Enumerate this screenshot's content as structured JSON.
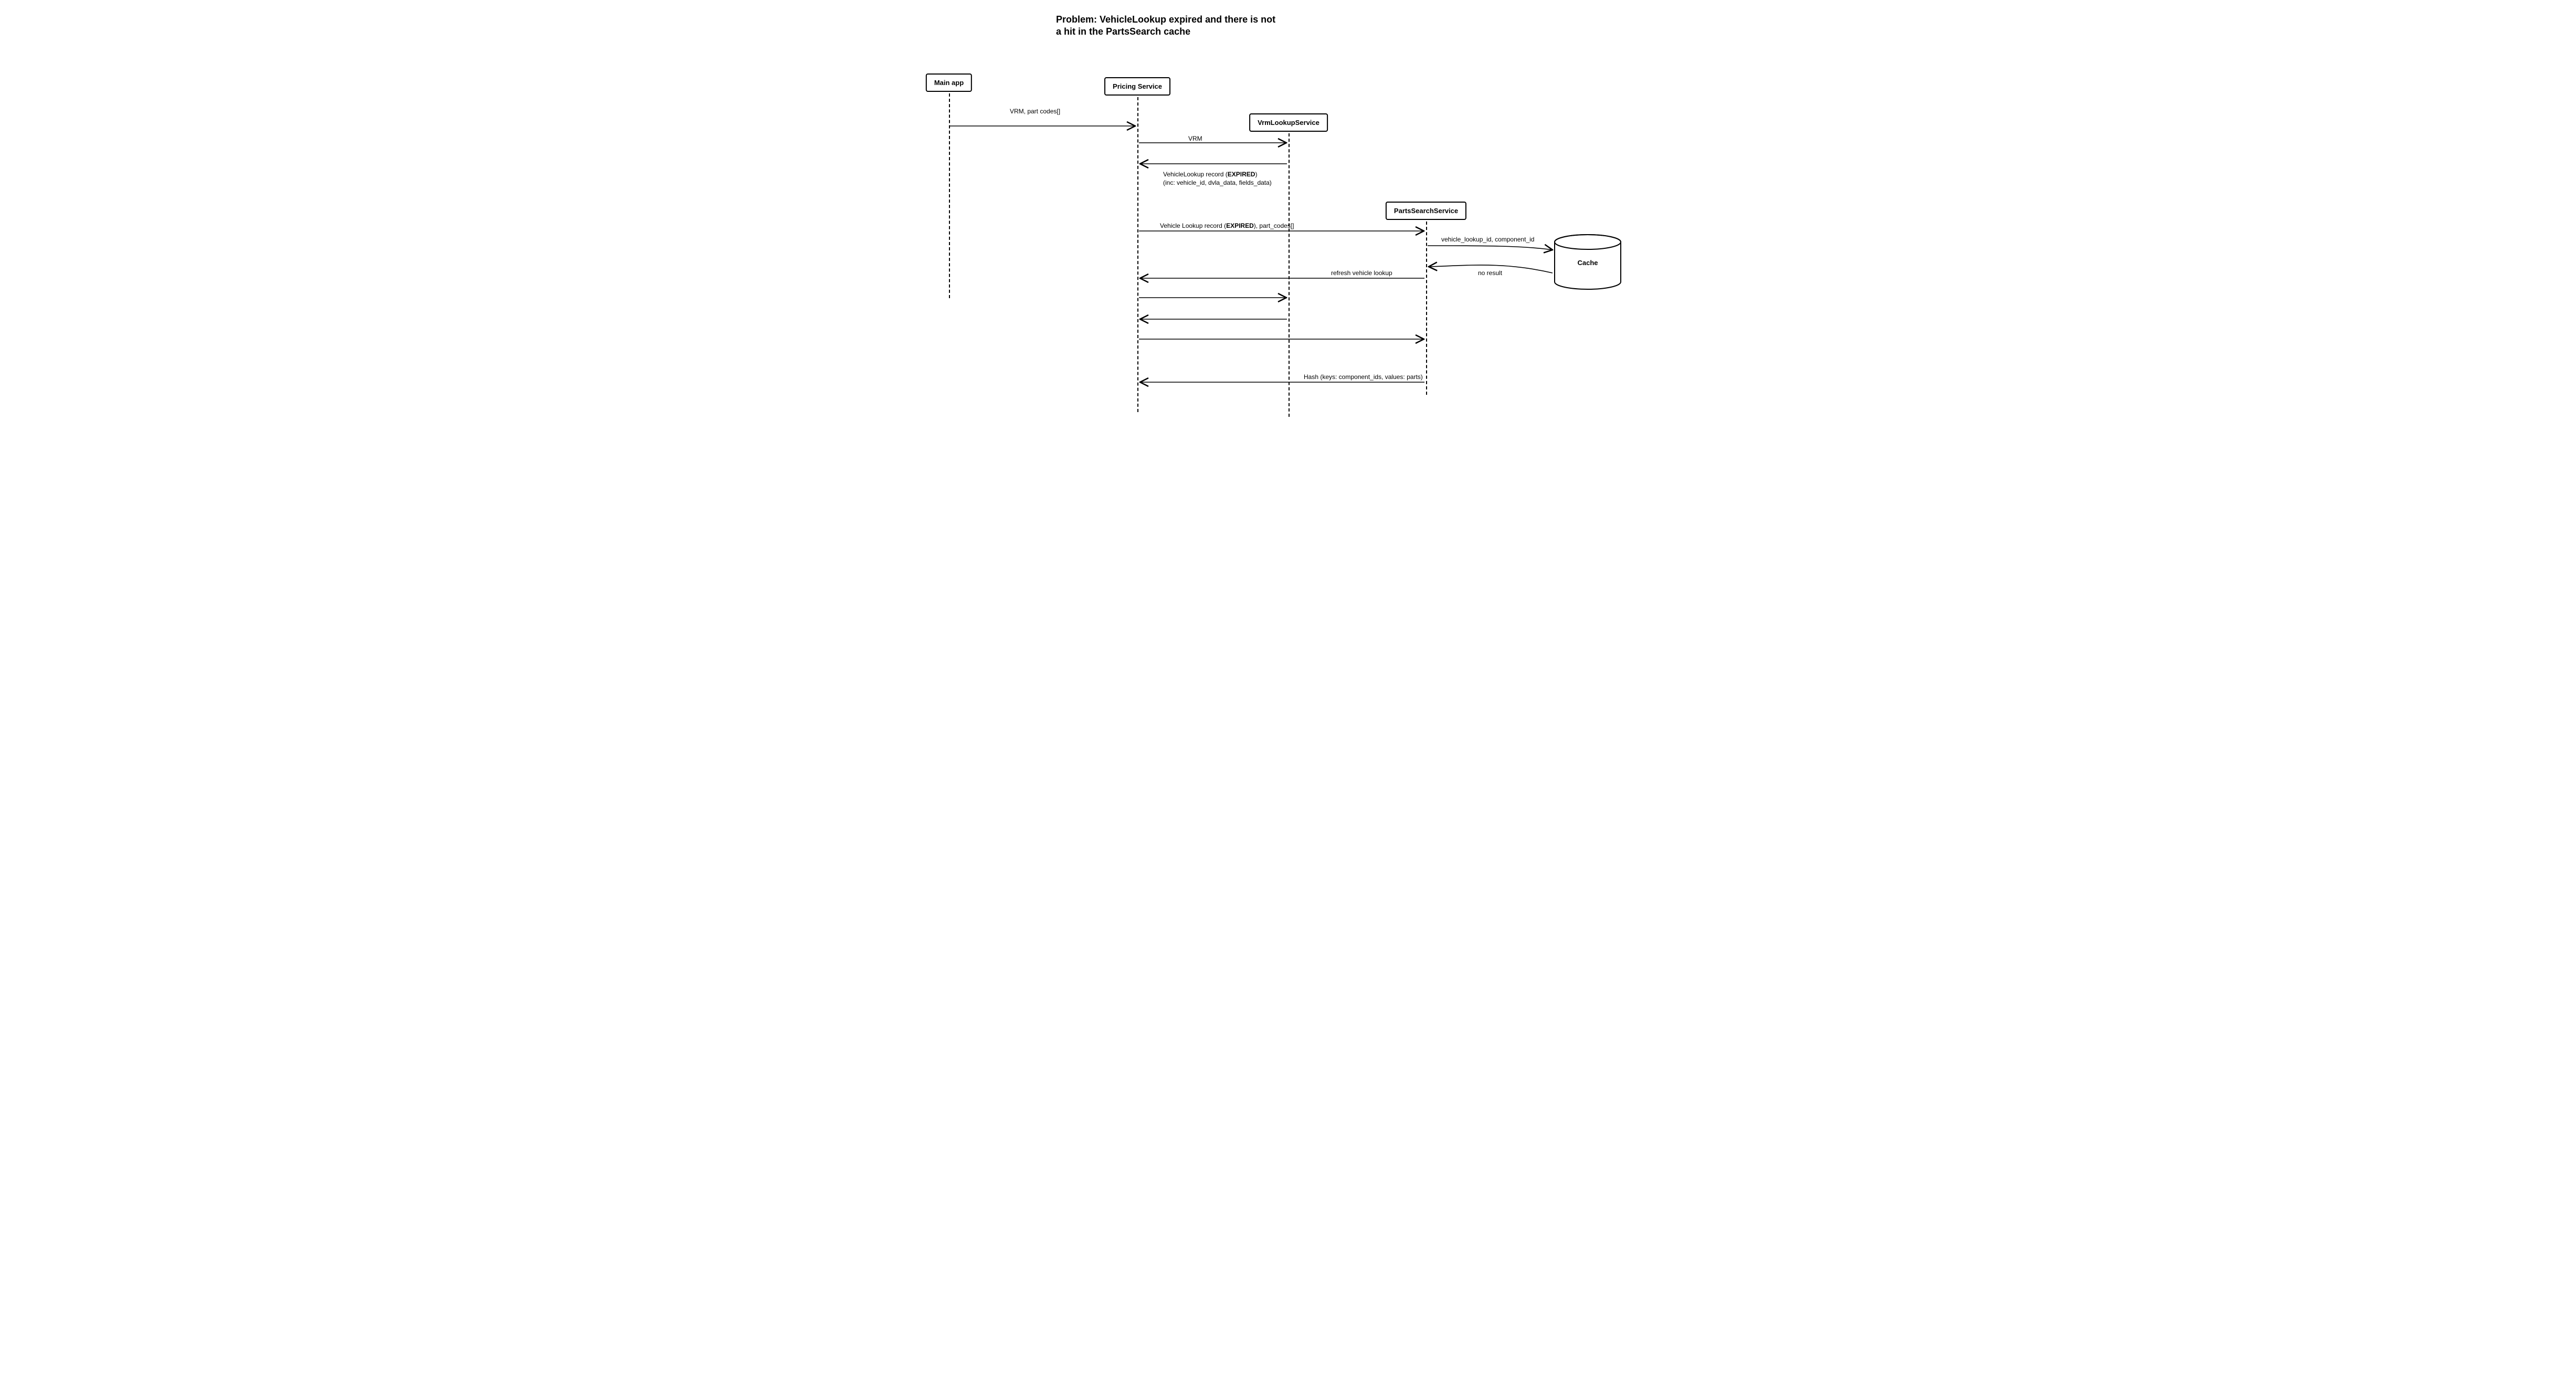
{
  "title_line1": "Problem: VehicleLookup expired and there is not",
  "title_line2": "a hit in the PartsSearch cache",
  "participants": {
    "main_app": "Main app",
    "pricing_service": "Pricing Service",
    "vrm_lookup_service": "VrmLookupService",
    "parts_search_service": "PartsSearchService",
    "cache": "Cache"
  },
  "messages": {
    "m1": "VRM, part codes[]",
    "m2": "VRM",
    "m3_line1_prefix": "VehicleLookup record (",
    "m3_line1_bold": "EXPIRED",
    "m3_line1_suffix": ")",
    "m3_line2": "(inc: vehicle_id, dvla_data, fields_data)",
    "m4_prefix": "Vehicle Lookup record (",
    "m4_bold": "EXPIRED",
    "m4_suffix": "), part_codes[]",
    "m5": "vehicle_lookup_id, component_id",
    "m6": "no result",
    "m7": "refresh vehicle lookup",
    "m8": "Hash (keys: component_ids, values: parts)"
  },
  "chart_data": {
    "type": "sequence-diagram",
    "title": "Problem: VehicleLookup expired and there is not a hit in the PartsSearch cache",
    "participants": [
      "Main app",
      "Pricing Service",
      "VrmLookupService",
      "PartsSearchService",
      "Cache"
    ],
    "participant_kinds": {
      "Main app": "actor",
      "Pricing Service": "actor",
      "VrmLookupService": "actor",
      "PartsSearchService": "actor",
      "Cache": "database"
    },
    "messages": [
      {
        "from": "Main app",
        "to": "Pricing Service",
        "label": "VRM, part codes[]"
      },
      {
        "from": "Pricing Service",
        "to": "VrmLookupService",
        "label": "VRM"
      },
      {
        "from": "VrmLookupService",
        "to": "Pricing Service",
        "label": "VehicleLookup record (EXPIRED) (inc: vehicle_id, dvla_data, fields_data)"
      },
      {
        "from": "Pricing Service",
        "to": "PartsSearchService",
        "label": "Vehicle Lookup record (EXPIRED), part_codes[]"
      },
      {
        "from": "PartsSearchService",
        "to": "Cache",
        "label": "vehicle_lookup_id, component_id"
      },
      {
        "from": "Cache",
        "to": "PartsSearchService",
        "label": "no result"
      },
      {
        "from": "PartsSearchService",
        "to": "Pricing Service",
        "label": "refresh vehicle lookup"
      },
      {
        "from": "Pricing Service",
        "to": "VrmLookupService",
        "label": ""
      },
      {
        "from": "VrmLookupService",
        "to": "Pricing Service",
        "label": ""
      },
      {
        "from": "Pricing Service",
        "to": "PartsSearchService",
        "label": ""
      },
      {
        "from": "PartsSearchService",
        "to": "Pricing Service",
        "label": "Hash (keys: component_ids, values: parts)"
      }
    ]
  }
}
